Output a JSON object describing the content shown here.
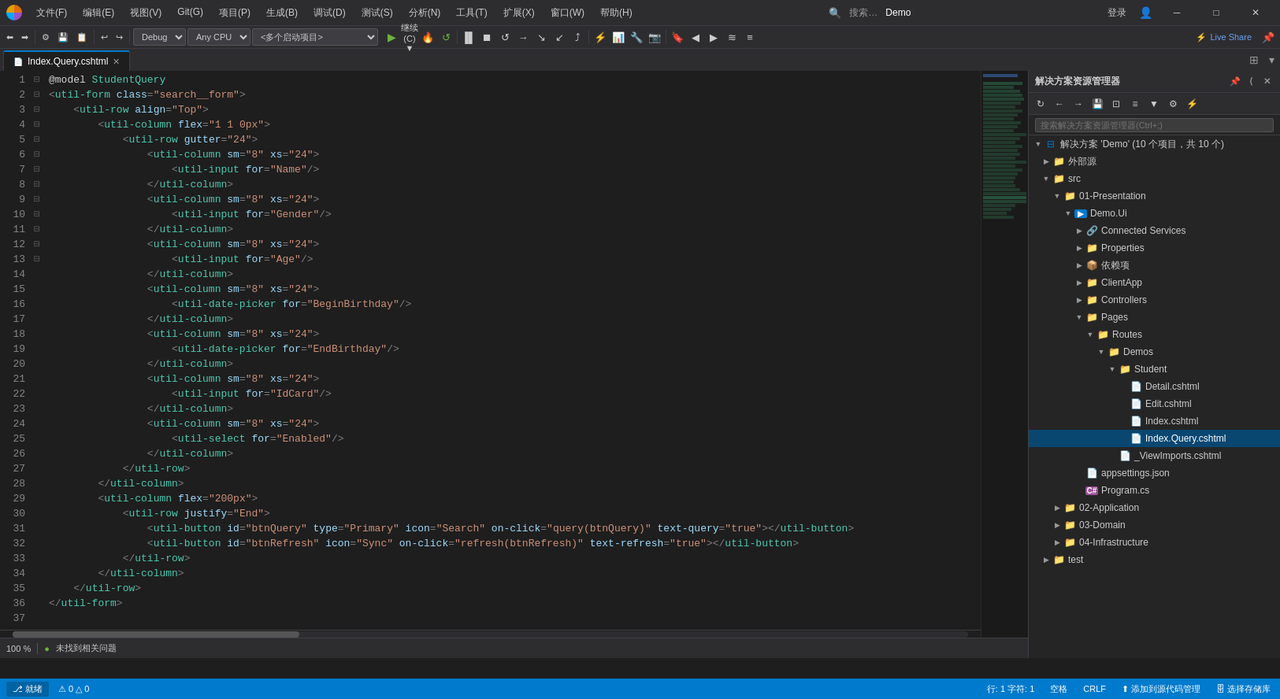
{
  "titlebar": {
    "menus": [
      "文件(F)",
      "编辑(E)",
      "视图(V)",
      "Git(G)",
      "项目(P)",
      "生成(B)",
      "调试(D)",
      "测试(S)",
      "分析(N)",
      "工具(T)",
      "扩展(X)",
      "窗口(W)",
      "帮助(H)"
    ],
    "search_placeholder": "搜索…",
    "project_name": "Demo",
    "user": "登录",
    "live_share": "Live Share"
  },
  "toolbar": {
    "debug_mode": "Debug",
    "cpu": "Any CPU",
    "startup": "<多个启动项目>",
    "continue": "继续(C)"
  },
  "tabs": [
    {
      "label": "Index.Query.cshtml",
      "active": true,
      "modified": false
    }
  ],
  "editor": {
    "lines": [
      {
        "num": 1,
        "fold": "",
        "code": "<span class='c-normal'>@model </span><span class='c-class'>StudentQuery</span>"
      },
      {
        "num": 2,
        "fold": "",
        "code": ""
      },
      {
        "num": 3,
        "fold": "",
        "code": "<span class='c-punct'>&lt;</span><span class='c-tag'>util-form</span> <span class='c-attr'>class</span><span class='c-punct'>=</span><span class='c-val'>\"search__form\"</span><span class='c-punct'>&gt;</span>"
      },
      {
        "num": 4,
        "fold": "⊟",
        "code": "    <span class='c-punct'>&lt;</span><span class='c-tag'>util-row</span> <span class='c-attr'>align</span><span class='c-punct'>=</span><span class='c-val'>\"Top\"</span><span class='c-punct'>&gt;</span>"
      },
      {
        "num": 5,
        "fold": "⊟",
        "code": "        <span class='c-punct'>&lt;</span><span class='c-tag'>util-column</span> <span class='c-attr'>flex</span><span class='c-punct'>=</span><span class='c-val'>\"1 1 0px\"</span><span class='c-punct'>&gt;</span>"
      },
      {
        "num": 6,
        "fold": "⊟",
        "code": "            <span class='c-punct'>&lt;</span><span class='c-tag'>util-row</span> <span class='c-attr'>gutter</span><span class='c-punct'>=</span><span class='c-val'>\"24\"</span><span class='c-punct'>&gt;</span>"
      },
      {
        "num": 7,
        "fold": "⊟",
        "code": "                <span class='c-punct'>&lt;</span><span class='c-tag'>util-column</span> <span class='c-attr'>sm</span><span class='c-punct'>=</span><span class='c-val'>\"8\"</span> <span class='c-attr'>xs</span><span class='c-punct'>=</span><span class='c-val'>\"24\"</span><span class='c-punct'>&gt;</span>"
      },
      {
        "num": 8,
        "fold": "",
        "code": "                    <span class='c-punct'>&lt;</span><span class='c-tag'>util-input</span> <span class='c-attr'>for</span><span class='c-punct'>=</span><span class='c-val'>\"Name\"</span><span class='c-punct'>/&gt;</span>"
      },
      {
        "num": 9,
        "fold": "",
        "code": "                <span class='c-punct'>&lt;/</span><span class='c-tag'>util-column</span><span class='c-punct'>&gt;</span>"
      },
      {
        "num": 10,
        "fold": "⊟",
        "code": "                <span class='c-punct'>&lt;</span><span class='c-tag'>util-column</span> <span class='c-attr'>sm</span><span class='c-punct'>=</span><span class='c-val'>\"8\"</span> <span class='c-attr'>xs</span><span class='c-punct'>=</span><span class='c-val'>\"24\"</span><span class='c-punct'>&gt;</span>"
      },
      {
        "num": 11,
        "fold": "",
        "code": "                    <span class='c-punct'>&lt;</span><span class='c-tag'>util-input</span> <span class='c-attr'>for</span><span class='c-punct'>=</span><span class='c-val'>\"Gender\"</span><span class='c-punct'>/&gt;</span>"
      },
      {
        "num": 12,
        "fold": "",
        "code": "                <span class='c-punct'>&lt;/</span><span class='c-tag'>util-column</span><span class='c-punct'>&gt;</span>"
      },
      {
        "num": 13,
        "fold": "⊟",
        "code": "                <span class='c-punct'>&lt;</span><span class='c-tag'>util-column</span> <span class='c-attr'>sm</span><span class='c-punct'>=</span><span class='c-val'>\"8\"</span> <span class='c-attr'>xs</span><span class='c-punct'>=</span><span class='c-val'>\"24\"</span><span class='c-punct'>&gt;</span>"
      },
      {
        "num": 14,
        "fold": "",
        "code": "                    <span class='c-punct'>&lt;</span><span class='c-tag'>util-input</span> <span class='c-attr'>for</span><span class='c-punct'>=</span><span class='c-val'>\"Age\"</span><span class='c-punct'>/&gt;</span>"
      },
      {
        "num": 15,
        "fold": "",
        "code": "                <span class='c-punct'>&lt;/</span><span class='c-tag'>util-column</span><span class='c-punct'>&gt;</span>"
      },
      {
        "num": 16,
        "fold": "⊟",
        "code": "                <span class='c-punct'>&lt;</span><span class='c-tag'>util-column</span> <span class='c-attr'>sm</span><span class='c-punct'>=</span><span class='c-val'>\"8\"</span> <span class='c-attr'>xs</span><span class='c-punct'>=</span><span class='c-val'>\"24\"</span><span class='c-punct'>&gt;</span>"
      },
      {
        "num": 17,
        "fold": "",
        "code": "                    <span class='c-punct'>&lt;</span><span class='c-tag'>util-date-picker</span> <span class='c-attr'>for</span><span class='c-punct'>=</span><span class='c-val'>\"BeginBirthday\"</span><span class='c-punct'>/&gt;</span>"
      },
      {
        "num": 18,
        "fold": "",
        "code": "                <span class='c-punct'>&lt;/</span><span class='c-tag'>util-column</span><span class='c-punct'>&gt;</span>"
      },
      {
        "num": 19,
        "fold": "⊟",
        "code": "                <span class='c-punct'>&lt;</span><span class='c-tag'>util-column</span> <span class='c-attr'>sm</span><span class='c-punct'>=</span><span class='c-val'>\"8\"</span> <span class='c-attr'>xs</span><span class='c-punct'>=</span><span class='c-val'>\"24\"</span><span class='c-punct'>&gt;</span>"
      },
      {
        "num": 20,
        "fold": "",
        "code": "                    <span class='c-punct'>&lt;</span><span class='c-tag'>util-date-picker</span> <span class='c-attr'>for</span><span class='c-punct'>=</span><span class='c-val'>\"EndBirthday\"</span><span class='c-punct'>/&gt;</span>"
      },
      {
        "num": 21,
        "fold": "",
        "code": "                <span class='c-punct'>&lt;/</span><span class='c-tag'>util-column</span><span class='c-punct'>&gt;</span>"
      },
      {
        "num": 22,
        "fold": "⊟",
        "code": "                <span class='c-punct'>&lt;</span><span class='c-tag'>util-column</span> <span class='c-attr'>sm</span><span class='c-punct'>=</span><span class='c-val'>\"8\"</span> <span class='c-attr'>xs</span><span class='c-punct'>=</span><span class='c-val'>\"24\"</span><span class='c-punct'>&gt;</span>"
      },
      {
        "num": 23,
        "fold": "",
        "code": "                    <span class='c-punct'>&lt;</span><span class='c-tag'>util-input</span> <span class='c-attr'>for</span><span class='c-punct'>=</span><span class='c-val'>\"IdCard\"</span><span class='c-punct'>/&gt;</span>"
      },
      {
        "num": 24,
        "fold": "",
        "code": "                <span class='c-punct'>&lt;/</span><span class='c-tag'>util-column</span><span class='c-punct'>&gt;</span>"
      },
      {
        "num": 25,
        "fold": "⊟",
        "code": "                <span class='c-punct'>&lt;</span><span class='c-tag'>util-column</span> <span class='c-attr'>sm</span><span class='c-punct'>=</span><span class='c-val'>\"8\"</span> <span class='c-attr'>xs</span><span class='c-punct'>=</span><span class='c-val'>\"24\"</span><span class='c-punct'>&gt;</span>"
      },
      {
        "num": 26,
        "fold": "",
        "code": "                    <span class='c-punct'>&lt;</span><span class='c-tag'>util-select</span> <span class='c-attr'>for</span><span class='c-punct'>=</span><span class='c-val'>\"Enabled\"</span><span class='c-punct'>/&gt;</span>"
      },
      {
        "num": 27,
        "fold": "",
        "code": "                <span class='c-punct'>&lt;/</span><span class='c-tag'>util-column</span><span class='c-punct'>&gt;</span>"
      },
      {
        "num": 28,
        "fold": "",
        "code": "            <span class='c-punct'>&lt;/</span><span class='c-tag'>util-row</span><span class='c-punct'>&gt;</span>"
      },
      {
        "num": 29,
        "fold": "",
        "code": "        <span class='c-punct'>&lt;/</span><span class='c-tag'>util-column</span><span class='c-punct'>&gt;</span>"
      },
      {
        "num": 30,
        "fold": "⊟",
        "code": "        <span class='c-punct'>&lt;</span><span class='c-tag'>util-column</span> <span class='c-attr'>flex</span><span class='c-punct'>=</span><span class='c-val'>\"200px\"</span><span class='c-punct'>&gt;</span>"
      },
      {
        "num": 31,
        "fold": "⊟",
        "code": "            <span class='c-punct'>&lt;</span><span class='c-tag'>util-row</span> <span class='c-attr'>justify</span><span class='c-punct'>=</span><span class='c-val'>\"End\"</span><span class='c-punct'>&gt;</span>"
      },
      {
        "num": 32,
        "fold": "",
        "code": "                <span class='c-punct'>&lt;</span><span class='c-tag'>util-button</span> <span class='c-attr'>id</span><span class='c-punct'>=</span><span class='c-val'>\"btnQuery\"</span> <span class='c-attr'>type</span><span class='c-punct'>=</span><span class='c-val'>\"Primary\"</span> <span class='c-attr'>icon</span><span class='c-punct'>=</span><span class='c-val'>\"Search\"</span> <span class='c-attr'>on-click</span><span class='c-punct'>=</span><span class='c-val'>\"query(btnQuery)\"</span> <span class='c-attr'>text-query</span><span class='c-punct'>=</span><span class='c-val'>\"true\"</span><span class='c-punct'>&gt;&lt;/</span><span class='c-tag'>util-button</span><span class='c-punct'>&gt;</span>"
      },
      {
        "num": 33,
        "fold": "",
        "code": "                <span class='c-punct'>&lt;</span><span class='c-tag'>util-button</span> <span class='c-attr'>id</span><span class='c-punct'>=</span><span class='c-val'>\"btnRefresh\"</span> <span class='c-attr'>icon</span><span class='c-punct'>=</span><span class='c-val'>\"Sync\"</span> <span class='c-attr'>on-click</span><span class='c-punct'>=</span><span class='c-val'>\"refresh(btnRefresh)\"</span> <span class='c-attr'>text-refresh</span><span class='c-punct'>=</span><span class='c-val'>\"true\"</span><span class='c-punct'>&gt;&lt;/</span><span class='c-tag'>util-button</span><span class='c-punct'>&gt;</span>"
      },
      {
        "num": 34,
        "fold": "",
        "code": "            <span class='c-punct'>&lt;/</span><span class='c-tag'>util-row</span><span class='c-punct'>&gt;</span>"
      },
      {
        "num": 35,
        "fold": "",
        "code": "        <span class='c-punct'>&lt;/</span><span class='c-tag'>util-column</span><span class='c-punct'>&gt;</span>"
      },
      {
        "num": 36,
        "fold": "",
        "code": "    <span class='c-punct'>&lt;/</span><span class='c-tag'>util-row</span><span class='c-punct'>&gt;</span>"
      },
      {
        "num": 37,
        "fold": "",
        "code": "<span class='c-punct'>&lt;/</span><span class='c-tag'>util-form</span><span class='c-punct'>&gt;</span>"
      }
    ]
  },
  "solution_explorer": {
    "title": "解决方案资源管理器",
    "search_placeholder": "搜索解决方案资源管理器(Ctrl+;)",
    "solution_label": "解决方案 'Demo' (10 个项目，共 10 个)",
    "tree": [
      {
        "id": "ext-sources",
        "indent": 1,
        "expanded": false,
        "label": "外部源",
        "icon": "folder",
        "arrow": "▶"
      },
      {
        "id": "src",
        "indent": 1,
        "expanded": true,
        "label": "src",
        "icon": "folder",
        "arrow": "▼"
      },
      {
        "id": "01-presentation",
        "indent": 2,
        "expanded": true,
        "label": "01-Presentation",
        "icon": "folder",
        "arrow": "▼"
      },
      {
        "id": "demo-ui",
        "indent": 3,
        "expanded": true,
        "label": "Demo.Ui",
        "icon": "proj",
        "arrow": "▼"
      },
      {
        "id": "connected-services",
        "indent": 4,
        "expanded": false,
        "label": "Connected Services",
        "icon": "connected",
        "arrow": "▶"
      },
      {
        "id": "properties",
        "indent": 4,
        "expanded": false,
        "label": "Properties",
        "icon": "folder",
        "arrow": "▶"
      },
      {
        "id": "dependencies",
        "indent": 4,
        "expanded": false,
        "label": "依赖项",
        "icon": "dep",
        "arrow": "▶"
      },
      {
        "id": "clientapp",
        "indent": 4,
        "expanded": false,
        "label": "ClientApp",
        "icon": "folder",
        "arrow": "▶"
      },
      {
        "id": "controllers",
        "indent": 4,
        "expanded": false,
        "label": "Controllers",
        "icon": "folder",
        "arrow": "▶"
      },
      {
        "id": "pages",
        "indent": 4,
        "expanded": true,
        "label": "Pages",
        "icon": "folder",
        "arrow": "▼"
      },
      {
        "id": "routes",
        "indent": 5,
        "expanded": true,
        "label": "Routes",
        "icon": "folder",
        "arrow": "▼"
      },
      {
        "id": "demos",
        "indent": 6,
        "expanded": true,
        "label": "Demos",
        "icon": "folder",
        "arrow": "▼"
      },
      {
        "id": "student",
        "indent": 7,
        "expanded": true,
        "label": "Student",
        "icon": "folder",
        "arrow": "▼"
      },
      {
        "id": "detail",
        "indent": 8,
        "expanded": false,
        "label": "Detail.cshtml",
        "icon": "file",
        "arrow": ""
      },
      {
        "id": "edit",
        "indent": 8,
        "expanded": false,
        "label": "Edit.cshtml",
        "icon": "file",
        "arrow": ""
      },
      {
        "id": "index",
        "indent": 8,
        "expanded": false,
        "label": "Index.cshtml",
        "icon": "file",
        "arrow": ""
      },
      {
        "id": "index-query",
        "indent": 8,
        "expanded": false,
        "label": "Index.Query.cshtml",
        "icon": "file",
        "arrow": "",
        "selected": true
      },
      {
        "id": "viewimports",
        "indent": 7,
        "expanded": false,
        "label": "_ViewImports.cshtml",
        "icon": "file",
        "arrow": ""
      },
      {
        "id": "appsettings",
        "indent": 4,
        "expanded": false,
        "label": "appsettings.json",
        "icon": "file",
        "arrow": ""
      },
      {
        "id": "programcs",
        "indent": 4,
        "expanded": false,
        "label": "Program.cs",
        "icon": "cs",
        "arrow": ""
      },
      {
        "id": "02-application",
        "indent": 2,
        "expanded": false,
        "label": "02-Application",
        "icon": "folder",
        "arrow": "▶"
      },
      {
        "id": "03-domain",
        "indent": 2,
        "expanded": false,
        "label": "03-Domain",
        "icon": "folder",
        "arrow": "▶"
      },
      {
        "id": "04-infrastructure",
        "indent": 2,
        "expanded": false,
        "label": "04-Infrastructure",
        "icon": "folder",
        "arrow": "▶"
      },
      {
        "id": "test",
        "indent": 1,
        "expanded": false,
        "label": "test",
        "icon": "folder",
        "arrow": "▶"
      }
    ]
  },
  "statusbar": {
    "branch": "就绪",
    "errors": "0",
    "warnings": "0",
    "no_issues": "未找到相关问题",
    "line": "行: 1",
    "col": "字符: 1",
    "spaces": "空格",
    "encoding": "CRLF",
    "add_to_src": "添加到源代码管理",
    "select_repo": "选择存储库"
  }
}
